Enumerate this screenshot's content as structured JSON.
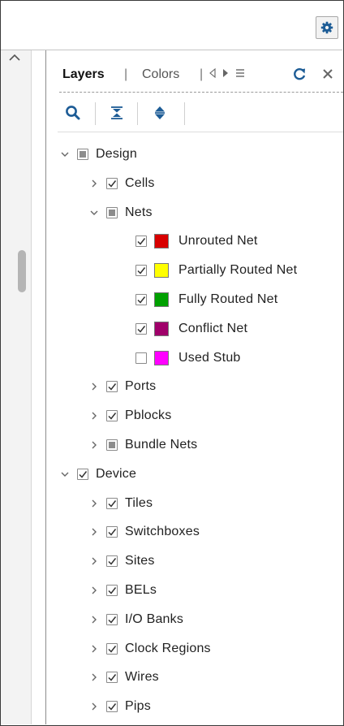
{
  "panel": {
    "tabs": {
      "active": "Layers",
      "inactive": "Colors",
      "separator": "|"
    }
  },
  "tree": [
    {
      "label": "Design",
      "level": 0,
      "expand": "expanded",
      "check": "partial"
    },
    {
      "label": "Cells",
      "level": 1,
      "expand": "collapsed",
      "check": "checked"
    },
    {
      "label": "Nets",
      "level": 1,
      "expand": "expanded",
      "check": "partial"
    },
    {
      "label": "Unrouted Net",
      "level": 2,
      "expand": "none",
      "check": "checked",
      "color": "#d80000"
    },
    {
      "label": "Partially Routed Net",
      "level": 2,
      "expand": "none",
      "check": "checked",
      "color": "#ffff00"
    },
    {
      "label": "Fully Routed Net",
      "level": 2,
      "expand": "none",
      "check": "checked",
      "color": "#00a000"
    },
    {
      "label": "Conflict Net",
      "level": 2,
      "expand": "none",
      "check": "checked",
      "color": "#a0006a"
    },
    {
      "label": "Used Stub",
      "level": 2,
      "expand": "none",
      "check": "unchecked",
      "color": "#ff00ff"
    },
    {
      "label": "Ports",
      "level": 1,
      "expand": "collapsed",
      "check": "checked"
    },
    {
      "label": "Pblocks",
      "level": 1,
      "expand": "collapsed",
      "check": "checked"
    },
    {
      "label": "Bundle Nets",
      "level": 1,
      "expand": "collapsed",
      "check": "partial"
    },
    {
      "label": "Device",
      "level": 0,
      "expand": "expanded",
      "check": "checked"
    },
    {
      "label": "Tiles",
      "level": 1,
      "expand": "collapsed",
      "check": "checked"
    },
    {
      "label": "Switchboxes",
      "level": 1,
      "expand": "collapsed",
      "check": "checked"
    },
    {
      "label": "Sites",
      "level": 1,
      "expand": "collapsed",
      "check": "checked"
    },
    {
      "label": "BELs",
      "level": 1,
      "expand": "collapsed",
      "check": "checked"
    },
    {
      "label": "I/O Banks",
      "level": 1,
      "expand": "collapsed",
      "check": "checked"
    },
    {
      "label": "Clock Regions",
      "level": 1,
      "expand": "collapsed",
      "check": "checked"
    },
    {
      "label": "Wires",
      "level": 1,
      "expand": "collapsed",
      "check": "checked"
    },
    {
      "label": "Pips",
      "level": 1,
      "expand": "collapsed",
      "check": "checked"
    }
  ],
  "colors": {
    "accent": "#1d5c96",
    "gear": "#1d5c96",
    "refresh": "#1d5c96"
  }
}
